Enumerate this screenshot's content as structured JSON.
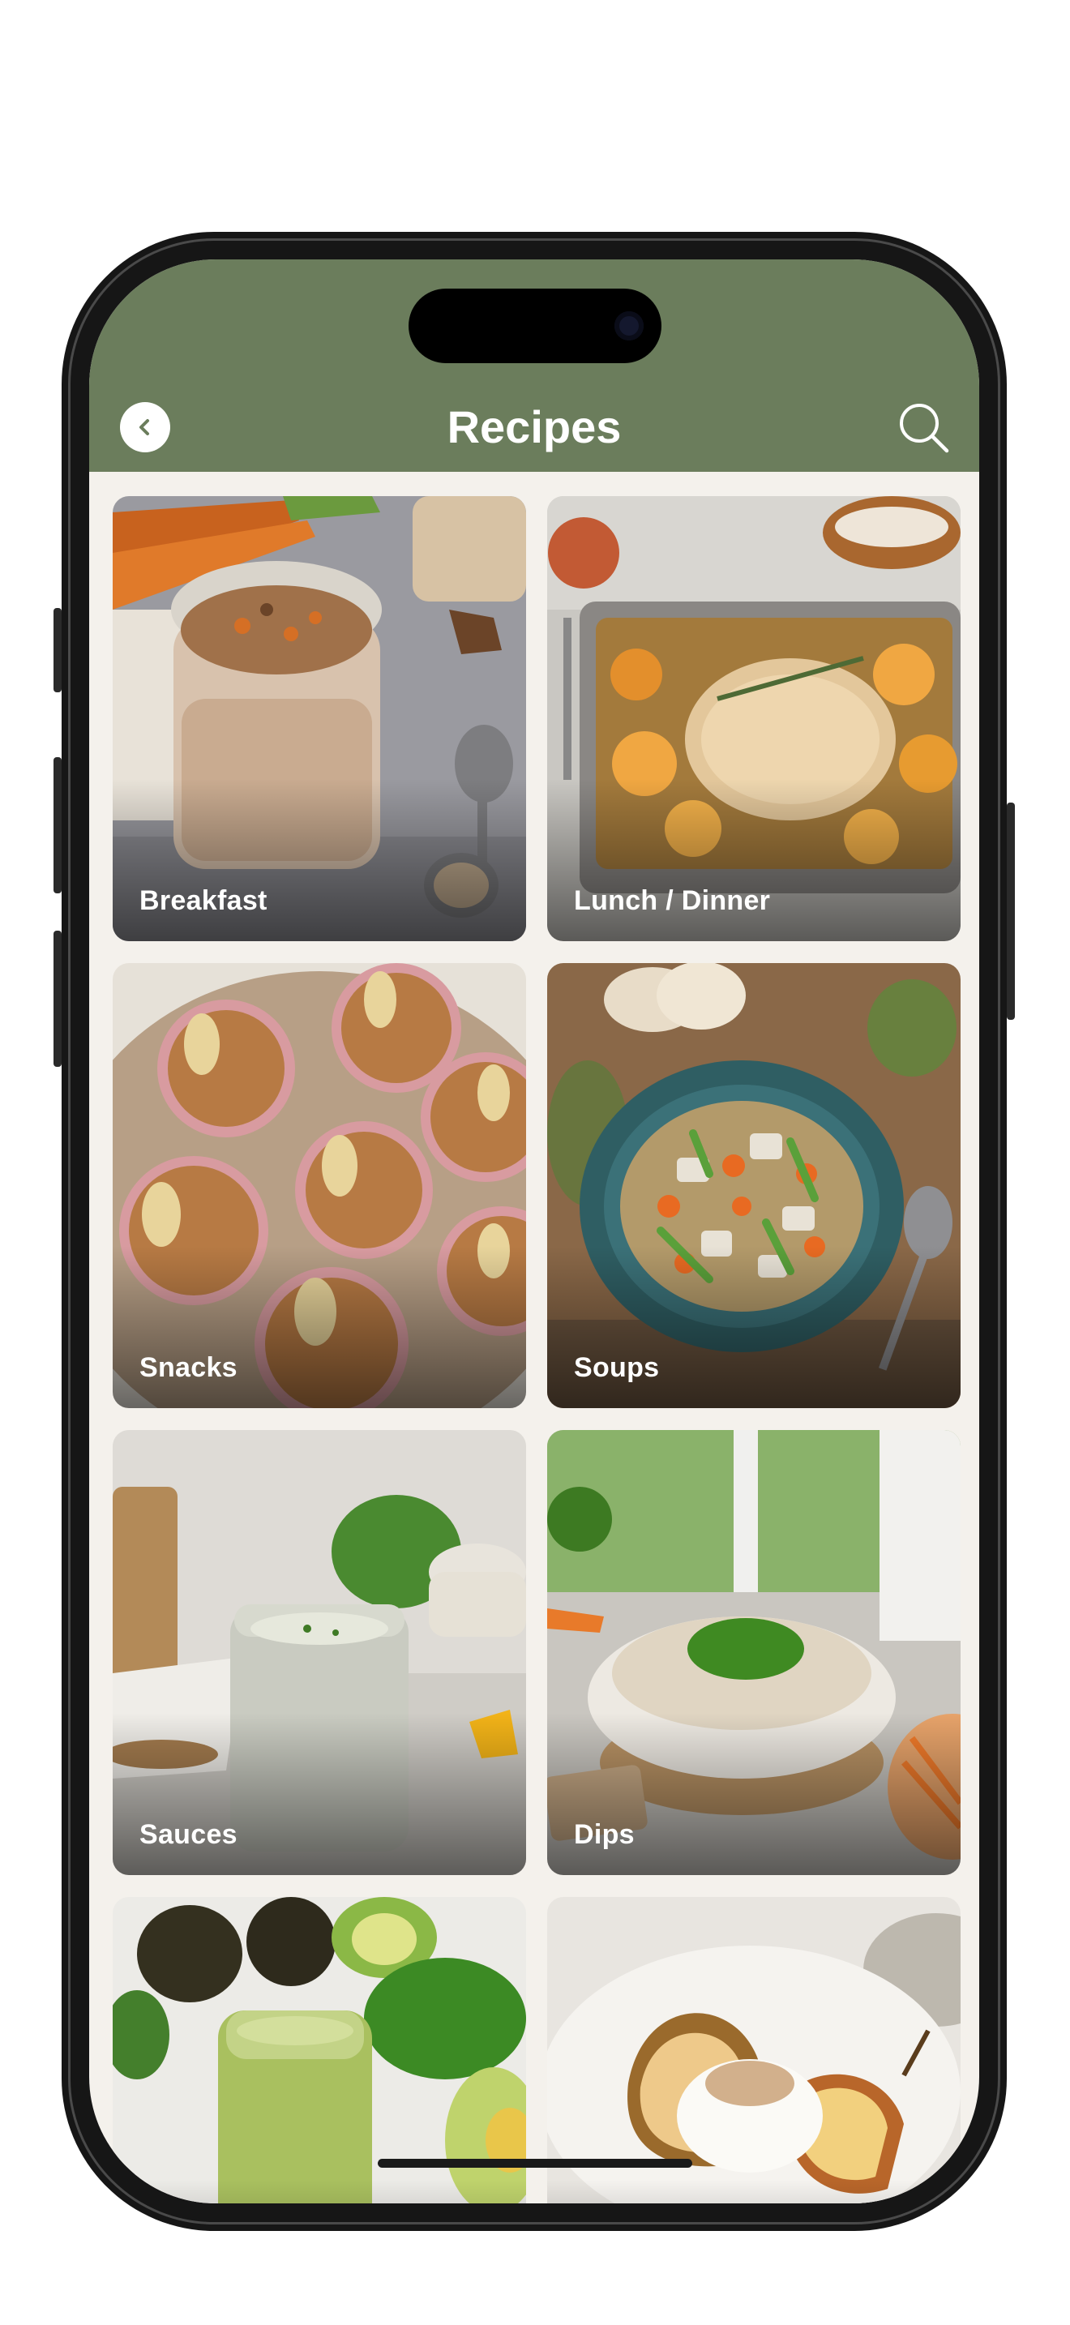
{
  "header": {
    "title": "Recipes",
    "back_icon": "chevron-left-icon",
    "search_icon": "search-icon",
    "background_color": "#6b7d5c"
  },
  "categories": [
    {
      "label": "Breakfast",
      "image": "overnight oats jar with carrots and pecans"
    },
    {
      "label": "Lunch / Dinner",
      "image": "baked chicken with squash in pan"
    },
    {
      "label": "Snacks",
      "image": "apple pecan muffins on board"
    },
    {
      "label": "Soups",
      "image": "chicken vegetable soup in teal pot"
    },
    {
      "label": "Sauces",
      "image": "creamy sauce in jar"
    },
    {
      "label": "Dips",
      "image": "creamy dip with chives in bowl"
    },
    {
      "label": "",
      "image": "green avocado dressing jar"
    },
    {
      "label": "",
      "image": "poached pear with cream"
    }
  ]
}
